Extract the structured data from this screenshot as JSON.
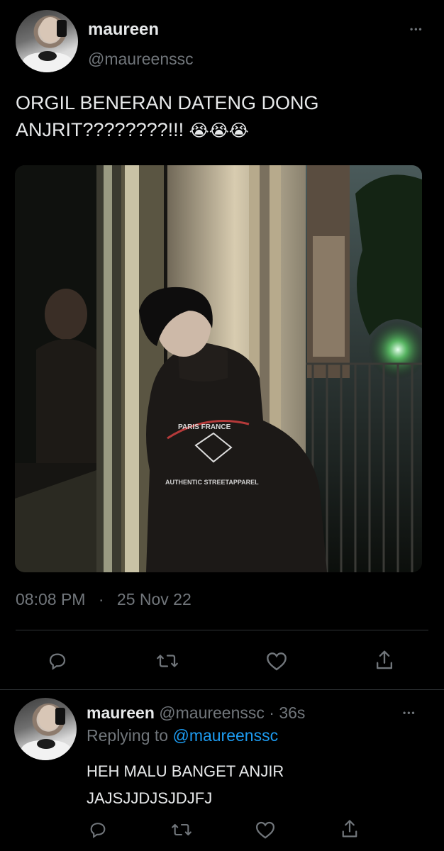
{
  "main_tweet": {
    "author_name": "maureen",
    "author_handle": "@maureenssc",
    "more_label": "•••",
    "text_line1": "ORGIL BENERAN DATENG DONG",
    "text_line2": "ANJRIT????????!!!",
    "emojis": [
      "😭",
      "😭",
      "😭"
    ],
    "time": "08:08 PM",
    "separator": "·",
    "date": "25 Nov 22"
  },
  "actions": {
    "reply_icon": "reply-icon",
    "retweet_icon": "retweet-icon",
    "like_icon": "heart-icon",
    "share_icon": "share-icon"
  },
  "reply_tweet": {
    "author_name": "maureen",
    "author_handle": "@maureenssc",
    "dot": "·",
    "age": "36s",
    "replying_prefix": "Replying to",
    "replying_to": "@maureenssc",
    "more_label": "•••",
    "text_line1": "HEH MALU BANGET ANJIR",
    "text_line2": "JAJSJJDJSJDJFJ"
  },
  "colors": {
    "background": "#000000",
    "text": "#e7e9ea",
    "muted": "#71767b",
    "link": "#1d9bf0",
    "divider": "#2f3336"
  }
}
